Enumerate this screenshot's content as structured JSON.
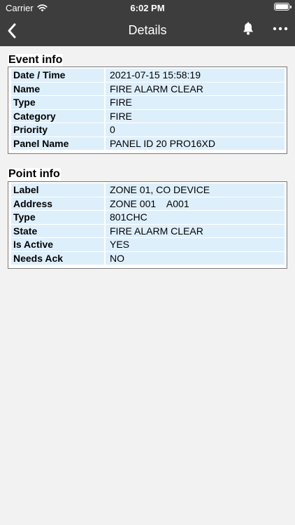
{
  "status_bar": {
    "carrier": "Carrier",
    "time": "6:02 PM"
  },
  "nav": {
    "title": "Details",
    "back_icon": "chevron-left-icon",
    "bell_icon": "bell-icon",
    "more_icon": "more-horizontal-icon"
  },
  "event_info": {
    "title": "Event info",
    "rows": [
      {
        "label": "Date / Time",
        "value": "2021-07-15 15:58:19"
      },
      {
        "label": "Name",
        "value": "FIRE ALARM CLEAR"
      },
      {
        "label": "Type",
        "value": "FIRE"
      },
      {
        "label": "Category",
        "value": "FIRE"
      },
      {
        "label": "Priority",
        "value": "0"
      },
      {
        "label": "Panel Name",
        "value": "PANEL ID 20 PRO16XD"
      }
    ]
  },
  "point_info": {
    "title": "Point info",
    "rows": [
      {
        "label": "Label",
        "value": "ZONE 01, CO DEVICE"
      },
      {
        "label": "Address",
        "value": "ZONE 001    A001"
      },
      {
        "label": "Type",
        "value": "801CHC"
      },
      {
        "label": "State",
        "value": "FIRE ALARM CLEAR"
      },
      {
        "label": "Is Active",
        "value": "YES"
      },
      {
        "label": "Needs Ack",
        "value": "NO"
      }
    ]
  },
  "colors": {
    "header_bg": "#3d3d3d",
    "page_bg": "#f2f2f2",
    "cell_bg": "#deeffc",
    "table_border": "#7a7a7a"
  }
}
